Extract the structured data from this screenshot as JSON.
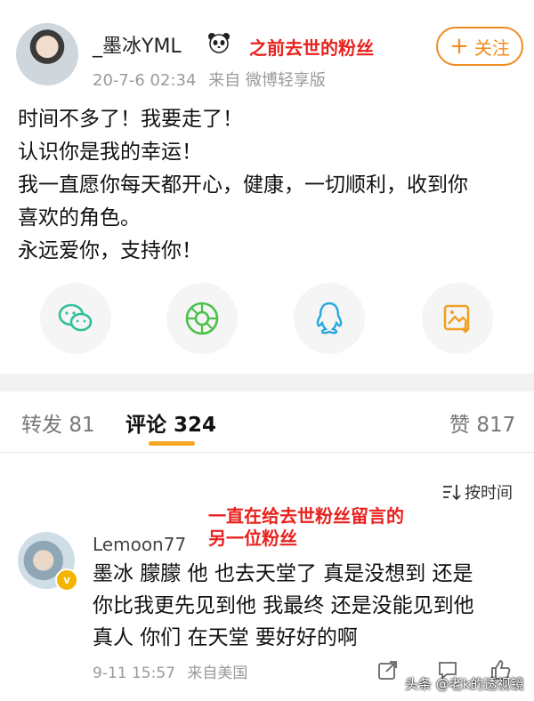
{
  "post": {
    "username": "_墨冰YML",
    "annotation_top": "之前去世的粉丝",
    "timestamp": "20-7-6 02:34",
    "source": "来自 微博轻享版",
    "follow_label": "关注",
    "lines": [
      "时间不多了！我要走了！",
      "认识你是我的幸运！",
      "我一直愿你每天都开心，健康，一切顺利，收到你",
      "喜欢的角色。",
      "永远爱你，支持你！"
    ]
  },
  "share_icons": [
    "wechat-icon",
    "moments-icon",
    "qq-icon",
    "save-image-icon"
  ],
  "tabs": {
    "repost_label": "转发",
    "repost_count": "81",
    "comment_label": "评论",
    "comment_count": "324",
    "like_label": "赞",
    "like_count": "817"
  },
  "sort_label": "按时间",
  "annotation_comment": [
    "一直在给去世粉丝留言的",
    "另一位粉丝"
  ],
  "comment": {
    "username": "Lemoon77",
    "lines": [
      "墨冰 朦朦 他 也去天堂了 真是没想到 还是",
      "你比我更先见到他 我最终 还是没能见到他",
      "真人 你们 在天堂 要好好的啊"
    ],
    "timestamp": "9-11 15:57",
    "location": "来自美国"
  },
  "watermark": "头条 @老k的透视镜",
  "colors": {
    "accent": "#f08b1f",
    "annotation": "#e8221e",
    "tab_underline": "#f5a623",
    "verified": "#f4b400"
  }
}
